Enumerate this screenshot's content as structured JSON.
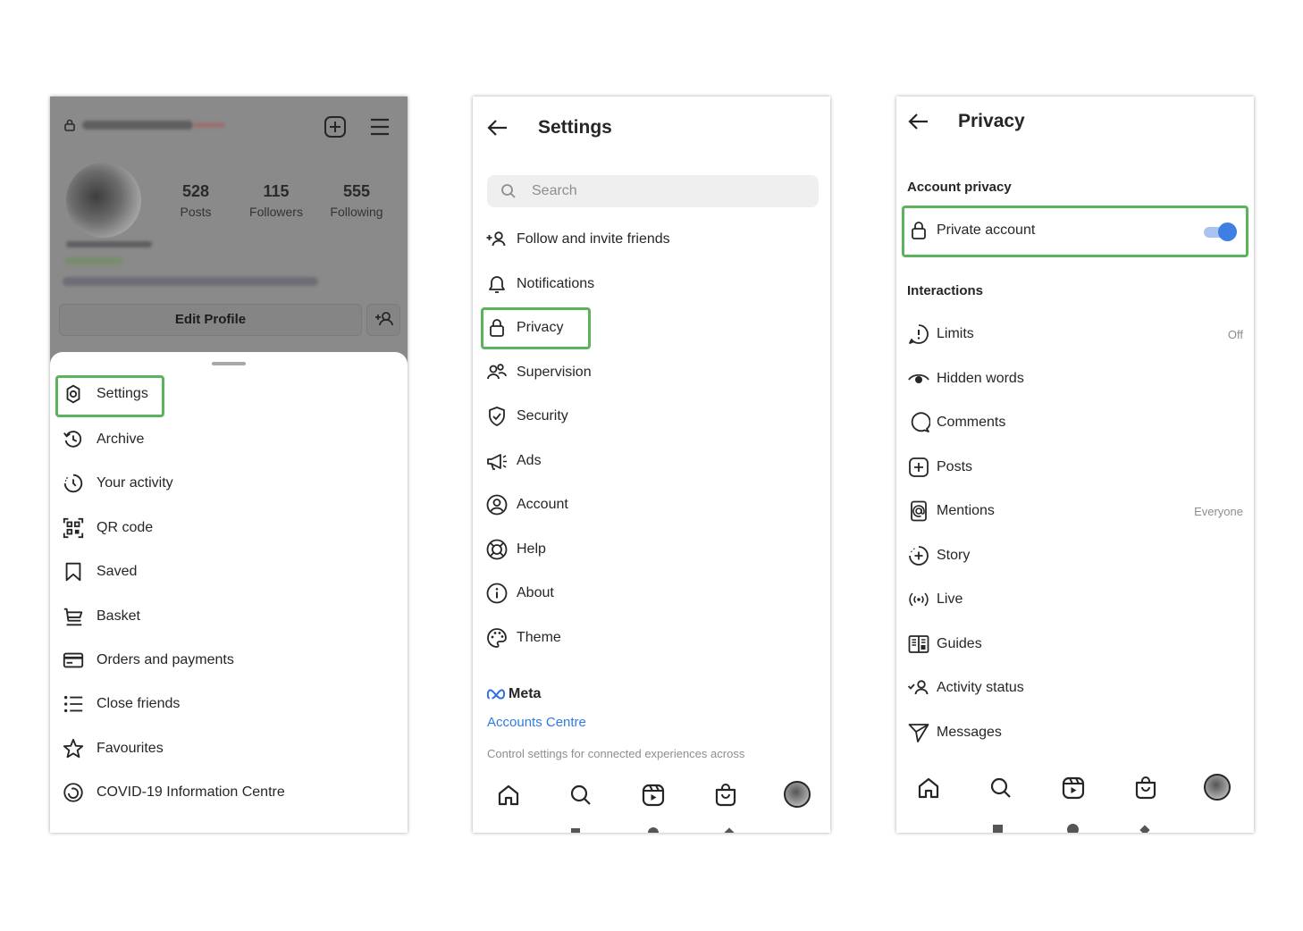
{
  "profile_panel": {
    "stats": [
      {
        "num": "528",
        "label": "Posts"
      },
      {
        "num": "115",
        "label": "Followers"
      },
      {
        "num": "555",
        "label": "Following"
      }
    ],
    "edit_profile_label": "Edit Profile",
    "menu": [
      {
        "label": "Settings",
        "icon": "settings-icon"
      },
      {
        "label": "Archive",
        "icon": "archive-icon"
      },
      {
        "label": "Your activity",
        "icon": "activity-icon"
      },
      {
        "label": "QR code",
        "icon": "qr-code-icon"
      },
      {
        "label": "Saved",
        "icon": "bookmark-icon"
      },
      {
        "label": "Basket",
        "icon": "basket-icon"
      },
      {
        "label": "Orders and payments",
        "icon": "card-icon"
      },
      {
        "label": "Close friends",
        "icon": "list-icon"
      },
      {
        "label": "Favourites",
        "icon": "star-icon"
      },
      {
        "label": "COVID-19 Information Centre",
        "icon": "covid-icon"
      }
    ]
  },
  "settings_panel": {
    "title": "Settings",
    "search_placeholder": "Search",
    "items": [
      {
        "label": "Follow and invite friends",
        "icon": "add-person-icon"
      },
      {
        "label": "Notifications",
        "icon": "bell-icon"
      },
      {
        "label": "Privacy",
        "icon": "lock-icon"
      },
      {
        "label": "Supervision",
        "icon": "supervision-icon"
      },
      {
        "label": "Security",
        "icon": "shield-icon"
      },
      {
        "label": "Ads",
        "icon": "megaphone-icon"
      },
      {
        "label": "Account",
        "icon": "account-icon"
      },
      {
        "label": "Help",
        "icon": "lifebuoy-icon"
      },
      {
        "label": "About",
        "icon": "info-icon"
      },
      {
        "label": "Theme",
        "icon": "palette-icon"
      }
    ],
    "meta_label": "Meta",
    "accounts_centre": "Accounts Centre",
    "accounts_desc": "Control settings for connected experiences across"
  },
  "privacy_panel": {
    "title": "Privacy",
    "account_privacy_heading": "Account privacy",
    "private_account_label": "Private account",
    "private_account_on": true,
    "interactions_heading": "Interactions",
    "items": [
      {
        "label": "Limits",
        "value": "Off",
        "icon": "limits-icon"
      },
      {
        "label": "Hidden words",
        "value": "",
        "icon": "eye-icon"
      },
      {
        "label": "Comments",
        "value": "",
        "icon": "comment-icon"
      },
      {
        "label": "Posts",
        "value": "",
        "icon": "plus-square-icon"
      },
      {
        "label": "Mentions",
        "value": "Everyone",
        "icon": "at-icon"
      },
      {
        "label": "Story",
        "value": "",
        "icon": "story-icon"
      },
      {
        "label": "Live",
        "value": "",
        "icon": "live-icon"
      },
      {
        "label": "Guides",
        "value": "",
        "icon": "guides-icon"
      },
      {
        "label": "Activity status",
        "value": "",
        "icon": "activity-status-icon"
      },
      {
        "label": "Messages",
        "value": "",
        "icon": "send-icon"
      }
    ]
  },
  "colors": {
    "highlight": "#5bb35b",
    "toggle_on": "#3f7fe3",
    "link": "#2f7be5"
  }
}
